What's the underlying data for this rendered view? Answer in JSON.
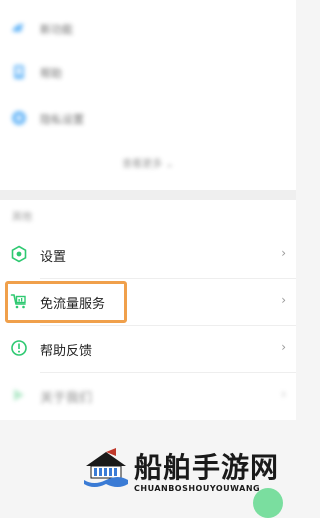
{
  "top_menu": {
    "items": [
      {
        "label": "新功能",
        "icon": "bird-icon",
        "color": "#3fa3f5"
      },
      {
        "label": "帮助",
        "icon": "phone-icon",
        "color": "#3fa3f5"
      },
      {
        "label": "隐私设置",
        "icon": "shield-icon",
        "color": "#3fa3f5"
      }
    ],
    "more_label": "查看更多 ⌄"
  },
  "section": {
    "title": "其他",
    "items": [
      {
        "label": "设置",
        "icon": "gear-icon"
      },
      {
        "label": "免流量服务",
        "icon": "cart-icon"
      },
      {
        "label": "帮助反馈",
        "icon": "info-icon"
      },
      {
        "label": "关于我们",
        "icon": "leaf-icon"
      }
    ],
    "chevron": "›"
  },
  "watermark": {
    "title": "船舶手游网",
    "subtitle": "CHUANBOSHOUYOUWANG"
  },
  "colors": {
    "accent_green": "#2ec971",
    "highlight": "#f0a04b"
  }
}
